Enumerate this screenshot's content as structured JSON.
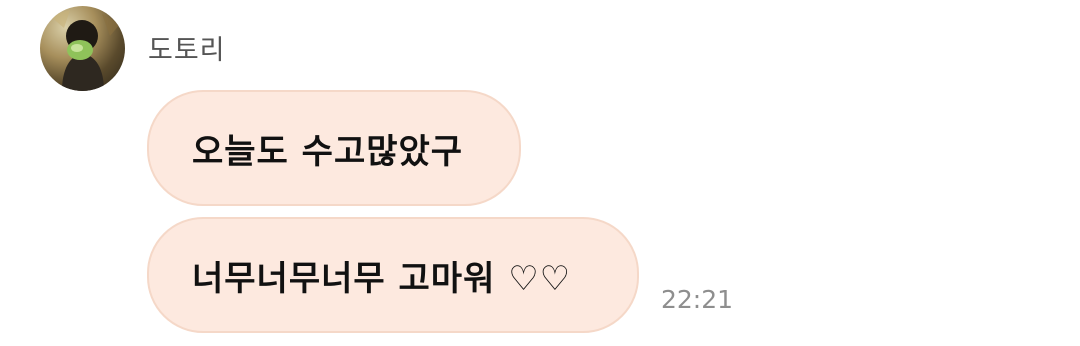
{
  "conversation": {
    "sender_name": "도토리",
    "messages": [
      {
        "text": "오늘도 수고많았구"
      },
      {
        "text": "너무너무너무 고마워 ♡♡"
      }
    ],
    "timestamp": "22:21"
  },
  "colors": {
    "bubble_background": "#fde9df",
    "bubble_border": "#f5d8c8",
    "sender_text": "#555555",
    "timestamp_text": "#8e8e8e"
  }
}
